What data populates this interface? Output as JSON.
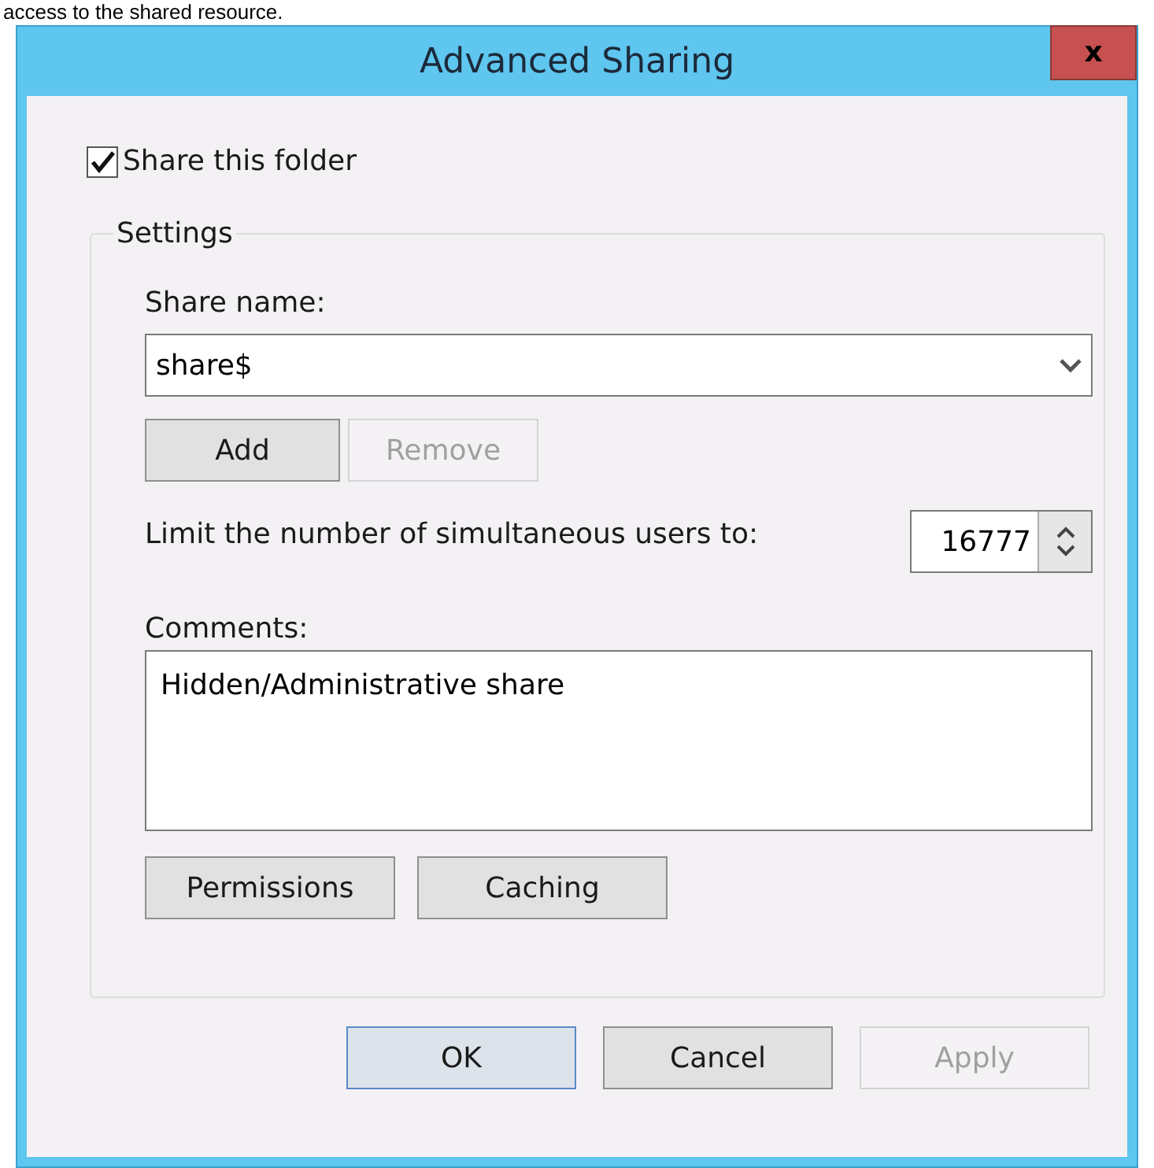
{
  "caption_above": "access to the shared resource.",
  "window": {
    "title": "Advanced Sharing",
    "close_label": "x"
  },
  "share_checkbox": {
    "label": "Share this folder",
    "checked": true
  },
  "settings": {
    "legend": "Settings",
    "share_name_label": "Share name:",
    "share_name_value": "share$",
    "share_buttons": [
      {
        "label": "Add",
        "disabled": false
      },
      {
        "label": "Remove",
        "disabled": true
      }
    ],
    "user_limit_label": "Limit the number of simultaneous users to:",
    "user_limit_value": "16777",
    "comments_label": "Comments:",
    "comments_value": "Hidden/Administrative share",
    "extra_buttons": [
      {
        "label": "Permissions",
        "disabled": false
      },
      {
        "label": "Caching",
        "disabled": false
      }
    ]
  },
  "footer_buttons": [
    {
      "label": "OK",
      "disabled": false,
      "default": true
    },
    {
      "label": "Cancel",
      "disabled": false,
      "default": false
    },
    {
      "label": "Apply",
      "disabled": true,
      "default": false
    }
  ]
}
